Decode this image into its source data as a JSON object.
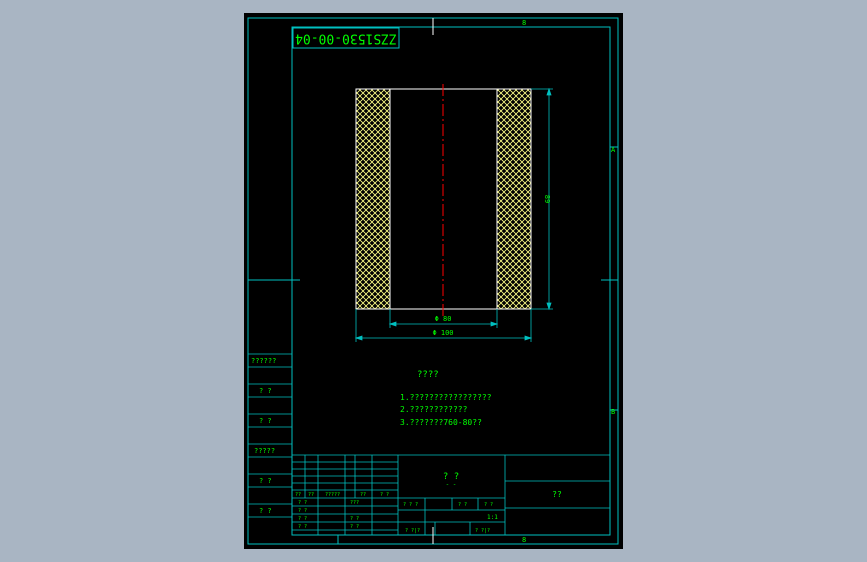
{
  "drawing": {
    "number": "ZZS1530-00-04",
    "zone_top_number": "8",
    "zone_bottom_number": "8",
    "zone_right_a": "A",
    "zone_right_b": "B",
    "dim_height": "89",
    "dim_inner": "Φ 80",
    "dim_outer": "Φ 100",
    "notes_title": "????",
    "notes": [
      "1.?????????????????",
      "2.????????????",
      "3.???????760-80??"
    ]
  },
  "left_strip": [
    "??????",
    "? ?",
    "? ?",
    "?????",
    "? ?",
    "? ?"
  ],
  "title_block": {
    "title_cell": "? ?",
    "title_sub": "- -",
    "name_cell": "??",
    "header_row": [
      "??",
      "??",
      "?????",
      "??",
      "? ?"
    ],
    "rows_left": [
      "? ?",
      "? ?",
      "? ?",
      "? ?"
    ],
    "rows_mid": [
      "???",
      "? ?",
      "? ?"
    ],
    "scale_labels": [
      "? ? ?",
      "? ?",
      "? ?"
    ],
    "scale_value": "1:1",
    "sheet_labels": [
      "? ?|?",
      "? ?|?"
    ]
  },
  "colors": {
    "background": "#a9b5c3",
    "paper": "#000000",
    "frame": "#00c0c0",
    "text": "#00ff00",
    "hatch": "#ffff88",
    "part": "#ffffff",
    "centerline": "#ff0000"
  }
}
